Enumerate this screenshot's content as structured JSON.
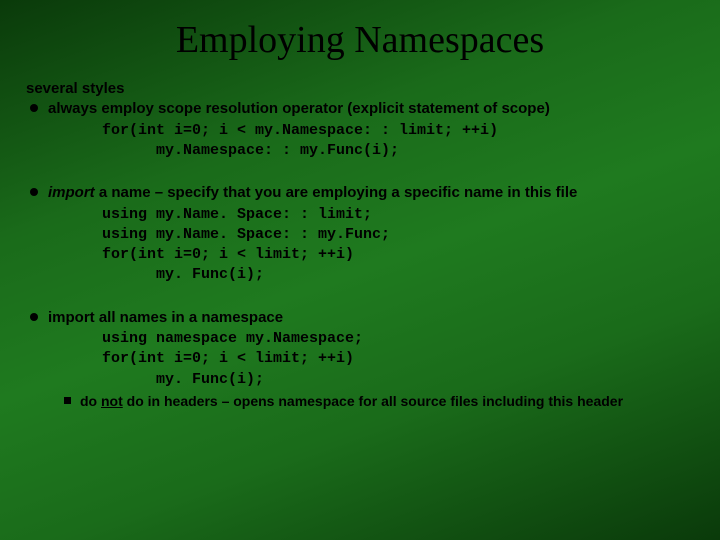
{
  "title": "Employing Namespaces",
  "intro": "several styles",
  "bullets": [
    {
      "text_a": "always employ scope resolution operator ",
      "text_b": "(explicit statement of scope)",
      "code": "for(int i=0; i < my.Namespace: : limit; ++i)",
      "code_indent": "my.Namespace: : my.Func(i);"
    },
    {
      "italic": "import",
      "text": " a name – specify that you are employing a specific name in this file",
      "code_lines": [
        "using my.Name. Space: : limit;",
        "using my.Name. Space: : my.Func;",
        "for(int i=0; i < limit; ++i)"
      ],
      "code_indent": "my. Func(i);"
    },
    {
      "text": "import all names in a namespace",
      "code_lines": [
        "using namespace my.Namespace;",
        "for(int i=0; i < limit; ++i)"
      ],
      "code_indent": "my. Func(i);",
      "sub": {
        "a": "do ",
        "not": "not",
        "b": " do in headers – opens namespace for all source files including this header"
      }
    }
  ]
}
